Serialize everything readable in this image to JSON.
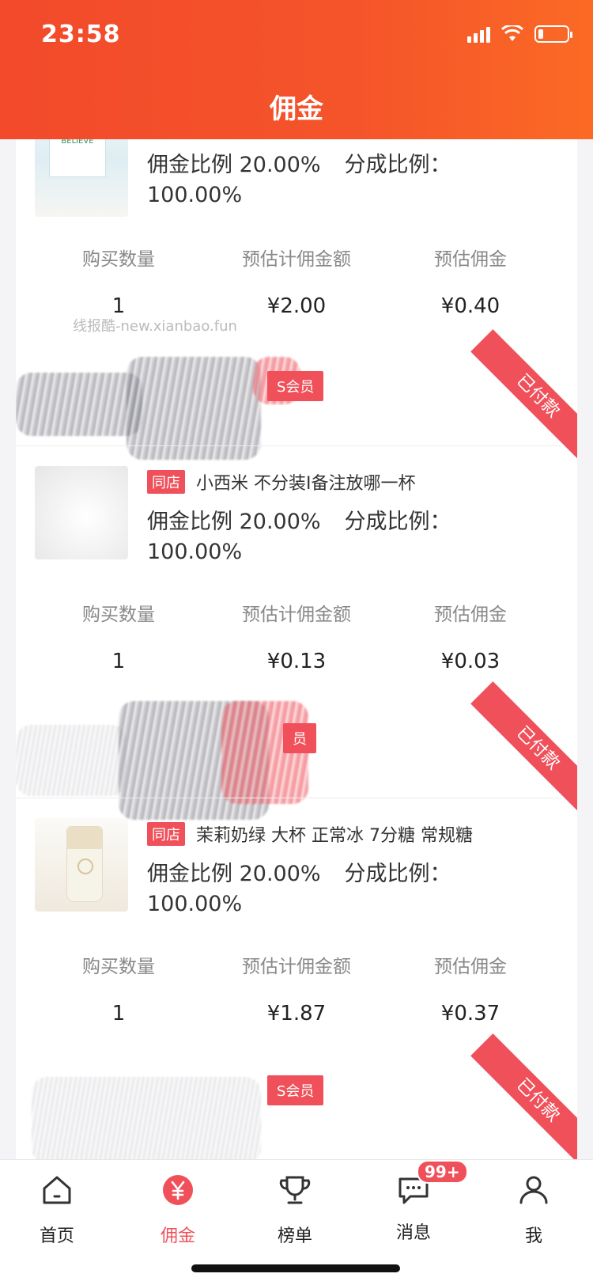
{
  "status_bar": {
    "time": "23:58"
  },
  "header": {
    "title": "佣金"
  },
  "cards": [
    {
      "rate_label": "佣金比例 20.00%",
      "share_label": "分成比例：",
      "share_value": "100.00%",
      "stats": {
        "qty_label": "购买数量",
        "qty": "1",
        "amount_label": "预估计佣金额",
        "amount": "¥2.00",
        "commission_label": "预估佣金",
        "commission": "¥0.40"
      }
    },
    {
      "status": "已付款",
      "member_tag": "S会员",
      "shop_tag": "同店",
      "product": "小西米 不分装I备注放哪一杯",
      "rate_label": "佣金比例 20.00%",
      "share_label": "分成比例：",
      "share_value": "100.00%",
      "stats": {
        "qty_label": "购买数量",
        "qty": "1",
        "amount_label": "预估计佣金额",
        "amount": "¥0.13",
        "commission_label": "预估佣金",
        "commission": "¥0.03"
      }
    },
    {
      "status": "已付款",
      "member_tag": "员",
      "shop_tag": "同店",
      "product": "茉莉奶绿 大杯 正常冰 7分糖 常规糖",
      "rate_label": "佣金比例 20.00%",
      "share_label": "分成比例：",
      "share_value": "100.00%",
      "stats": {
        "qty_label": "购买数量",
        "qty": "1",
        "amount_label": "预估计佣金额",
        "amount": "¥1.87",
        "commission_label": "预估佣金",
        "commission": "¥0.37"
      }
    },
    {
      "status": "已付款",
      "member_tag": "S会员"
    }
  ],
  "watermark": "线报酷-new.xianbao.fun",
  "tabbar": {
    "items": [
      {
        "label": "首页",
        "icon": "home-icon"
      },
      {
        "label": "佣金",
        "icon": "yen-icon",
        "active": true
      },
      {
        "label": "榜单",
        "icon": "trophy-icon"
      },
      {
        "label": "消息",
        "icon": "message-icon",
        "badge": "99+"
      },
      {
        "label": "我",
        "icon": "user-icon"
      }
    ]
  },
  "colors": {
    "header": "#f24a2b",
    "accent": "#f0505a"
  }
}
